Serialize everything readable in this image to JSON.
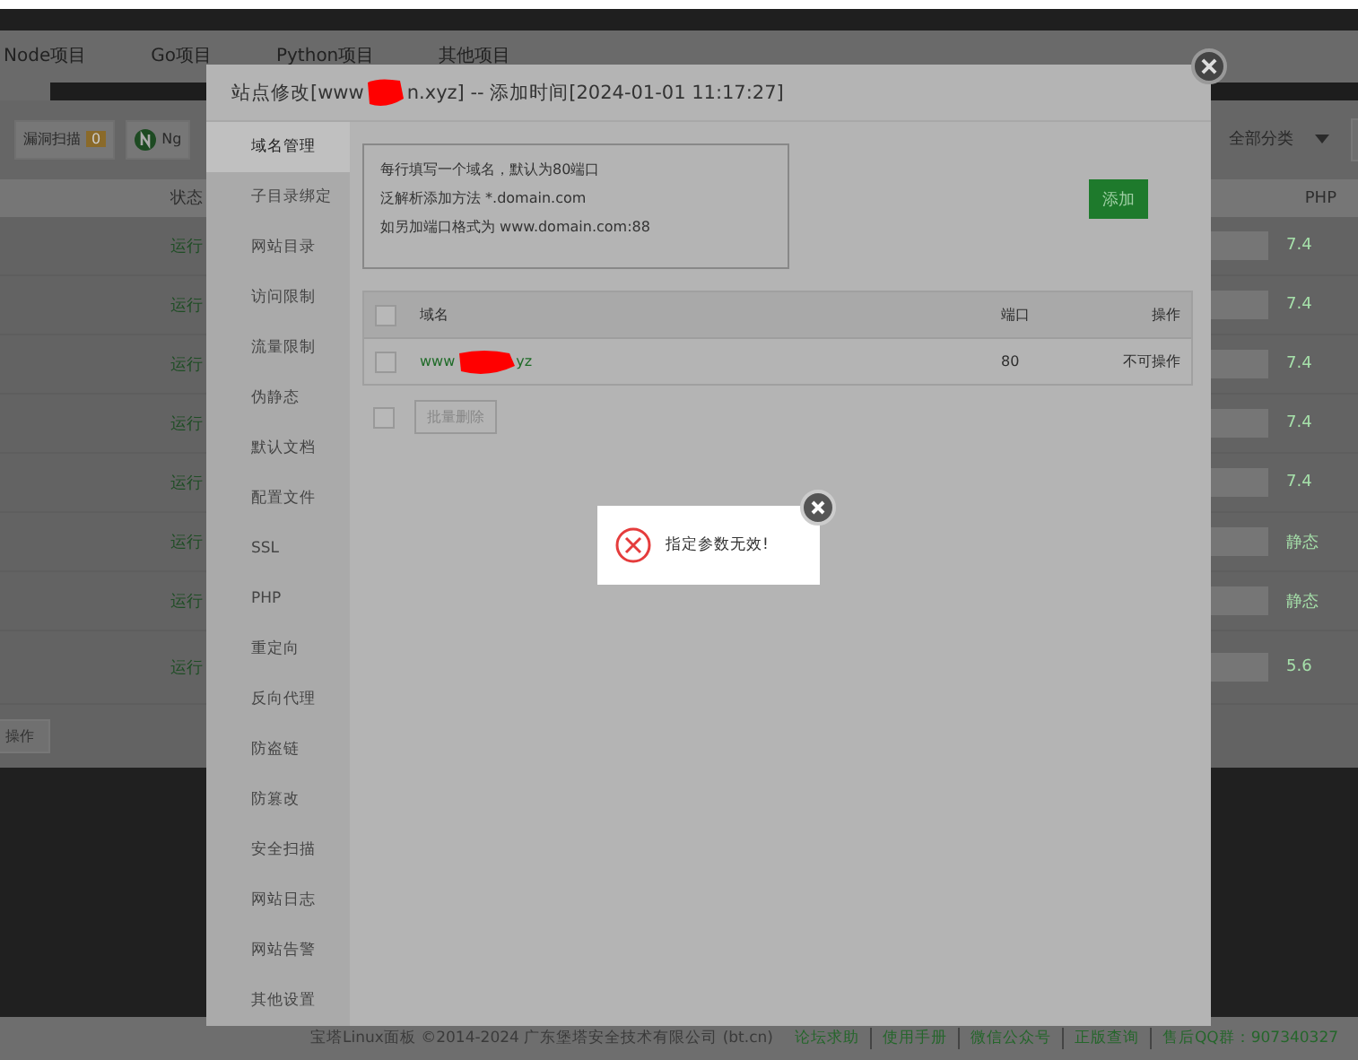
{
  "nav_tabs": [
    {
      "label": "Node项目"
    },
    {
      "label": "Go项目"
    },
    {
      "label": "Python项目"
    },
    {
      "label": "其他项目"
    }
  ],
  "toolbar": {
    "scan_button": {
      "label": "漏洞扫描",
      "badge": "0"
    },
    "nginx_button": {
      "label": "Ng"
    },
    "category_select": {
      "value": "全部分类"
    }
  },
  "site_table": {
    "columns": [
      "状态",
      "PHP"
    ],
    "rows": [
      {
        "status": "运行",
        "php": "7.4"
      },
      {
        "status": "运行",
        "php": "7.4"
      },
      {
        "status": "运行",
        "php": "7.4"
      },
      {
        "status": "运行",
        "php": "7.4"
      },
      {
        "status": "运行",
        "php": "7.4"
      },
      {
        "status": "运行",
        "php": "静态"
      },
      {
        "status": "运行",
        "php": "静态"
      },
      {
        "status": "运行",
        "php": "5.6"
      }
    ]
  },
  "bulk_button": "操作",
  "modal": {
    "title_prefix": "站点修改[www",
    "title_suffix": "n.xyz] -- 添加时间[2024-01-01 11:17:27]",
    "menu": [
      {
        "label": "域名管理",
        "selected": true
      },
      {
        "label": "子目录绑定",
        "selected": false
      },
      {
        "label": "网站目录",
        "selected": false
      },
      {
        "label": "访问限制",
        "selected": false
      },
      {
        "label": "流量限制",
        "selected": false
      },
      {
        "label": "伪静态",
        "selected": false
      },
      {
        "label": "默认文档",
        "selected": false
      },
      {
        "label": "配置文件",
        "selected": false
      },
      {
        "label": "SSL",
        "selected": false
      },
      {
        "label": "PHP",
        "selected": false
      },
      {
        "label": "重定向",
        "selected": false
      },
      {
        "label": "反向代理",
        "selected": false
      },
      {
        "label": "防盗链",
        "selected": false
      },
      {
        "label": "防篡改",
        "selected": false
      },
      {
        "label": "安全扫描",
        "selected": false
      },
      {
        "label": "网站日志",
        "selected": false
      },
      {
        "label": "网站告警",
        "selected": false
      },
      {
        "label": "其他设置",
        "selected": false
      }
    ],
    "domain_input": {
      "hint_lines": [
        "每行填写一个域名，默认为80端口",
        "泛解析添加方法 *.domain.com",
        "如另加端口格式为 www.domain.com:88"
      ]
    },
    "add_button": "添加",
    "domain_table": {
      "select_all_checked": false,
      "columns": [
        "域名",
        "端口",
        "操作"
      ],
      "rows": [
        {
          "domain_prefix": "www",
          "domain_suffix": "yz",
          "port": "80",
          "action": "不可操作",
          "checked": false
        }
      ]
    },
    "batch_checked": false,
    "batch_delete": "批量删除"
  },
  "toast": {
    "message": "指定参数无效!"
  },
  "footer": {
    "copyright": "宝塔Linux面板 ©2014-2024 广东堡塔安全技术有限公司 (bt.cn)",
    "links": [
      "论坛求助",
      "使用手册",
      "微信公众号",
      "正版查询",
      "售后QQ群：907340327"
    ]
  }
}
